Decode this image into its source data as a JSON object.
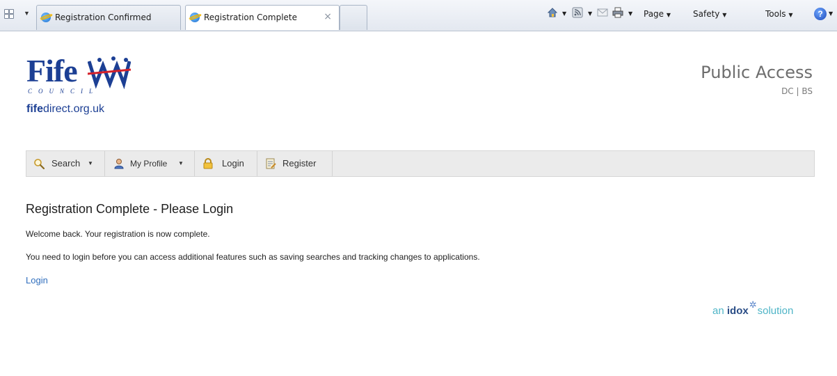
{
  "browser": {
    "tabs": [
      {
        "label": "Registration Confirmed"
      },
      {
        "label": "Registration Complete",
        "close": "×",
        "active": true
      }
    ],
    "commands": {
      "page": "Page",
      "safety": "Safety",
      "tools": "Tools",
      "help": "?"
    }
  },
  "header": {
    "logo_word": "Fife",
    "logo_council": "COUNCIL",
    "site_bold": "fife",
    "site_rest": "direct.org.uk",
    "title": "Public Access",
    "subtitle": "DC | BS"
  },
  "nav": {
    "items": [
      {
        "label": "Search",
        "icon": "magnifier-icon",
        "dropdown": true
      },
      {
        "label": "My Profile",
        "icon": "user-icon",
        "dropdown": true
      },
      {
        "label": "Login",
        "icon": "padlock-icon",
        "dropdown": false
      },
      {
        "label": "Register",
        "icon": "register-form-icon",
        "dropdown": false
      }
    ]
  },
  "main": {
    "title": "Registration Complete - Please Login",
    "welcome": "Welcome back. Your registration is now complete.",
    "info": "You need to login before you can access additional features such as saving searches and tracking changes to applications.",
    "login_link": "Login"
  },
  "footer": {
    "brand_prefix": "an",
    "brand_name": "idox",
    "brand_suffix": "solution"
  },
  "colors": {
    "brand_blue": "#1c3f94",
    "link": "#2f6ebd",
    "nav_bg": "#ebebeb",
    "idox_teal": "#4fb5c7"
  }
}
